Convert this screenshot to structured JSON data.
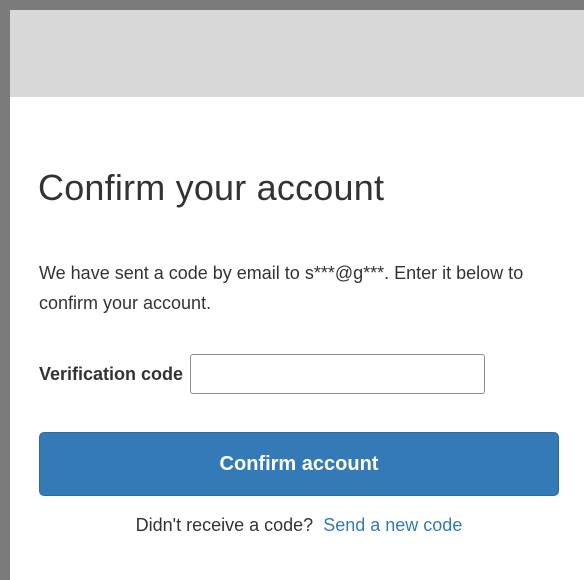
{
  "form": {
    "title": "Confirm your account",
    "message": "We have sent a code by email to s***@g***. Enter it below to confirm your account.",
    "code_label": "Verification code",
    "code_value": "",
    "confirm_button_label": "Confirm account",
    "resend_prompt": "Didn't receive a code?",
    "resend_link": "Send a new code"
  },
  "colors": {
    "accent": "#337ab7",
    "header_bar": "#d8d8d8",
    "frame_border": "#7b7b7b",
    "text": "#333333"
  }
}
